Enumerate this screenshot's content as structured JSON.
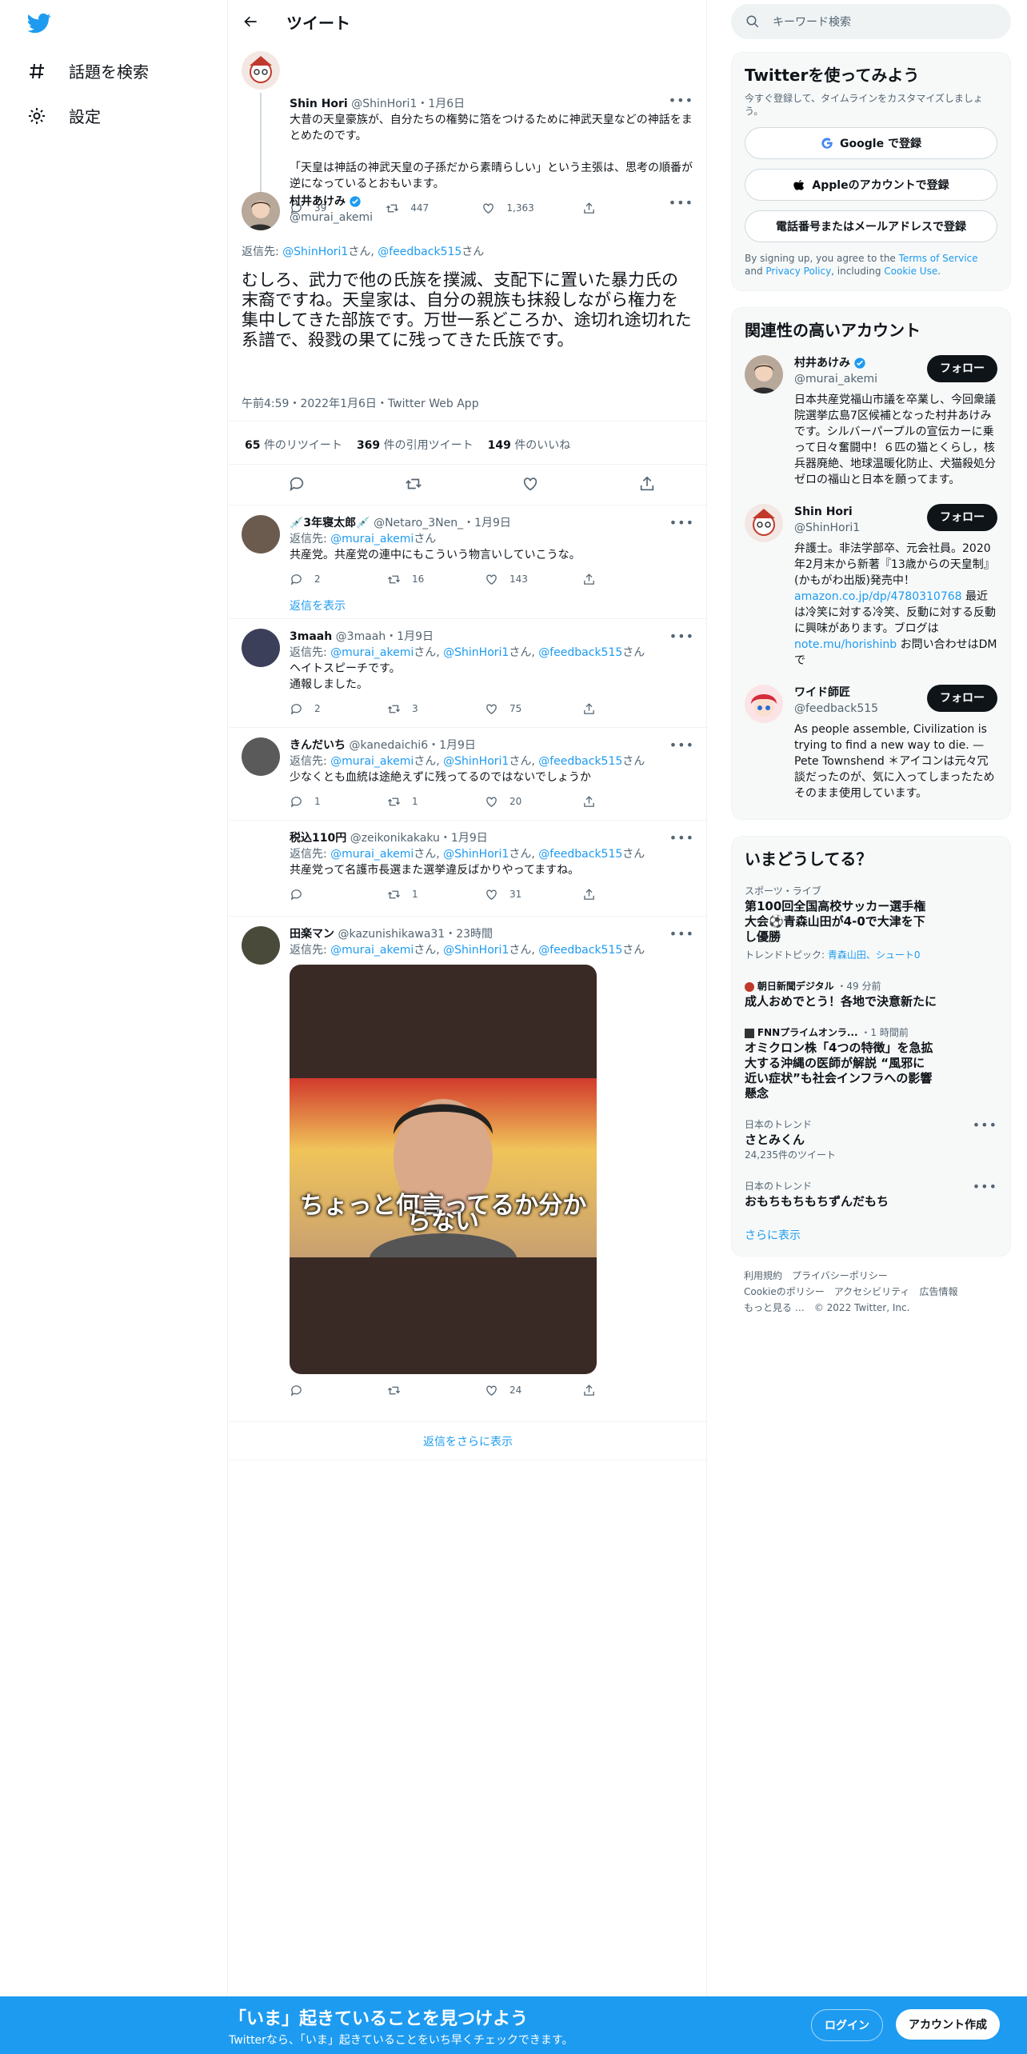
{
  "app": {
    "nav": {
      "explore": "話題を検索",
      "settings": "設定"
    }
  },
  "header": {
    "title": "ツイート"
  },
  "parent": {
    "name": "Shin Hori",
    "handle": "@ShinHori1",
    "date": "・1月6日",
    "text1": "大昔の天皇豪族が、自分たちの権勢に箔をつけるために神武天皇などの神話をまとめたのです。",
    "text2": "「天皇は神話の神武天皇の子孫だから素晴らしい」という主張は、思考の順番が逆になっているとおもいます。",
    "replies": "39",
    "retweets": "447",
    "likes": "1,363"
  },
  "main": {
    "name": "村井あけみ",
    "handle": "@murai_akemi",
    "reply_prefix": "返信先: ",
    "reply_to1": "@ShinHori1",
    "reply_san": "さん",
    "reply_comma": ", ",
    "reply_to2": "@feedback515",
    "text": "むしろ、武力で他の氏族を撲滅、支配下に置いた暴力氏の末裔ですね。天皇家は、自分の親族も抹殺しながら権力を集中してきた部族です。万世一系どころか、途切れ途切れた系譜で、殺戮の果てに残ってきた氏族です。",
    "meta": "午前4:59・2022年1月6日・Twitter Web App",
    "stats": {
      "rt_num": "65",
      "rt_label": "件のリツイート",
      "qt_num": "369",
      "qt_label": "件の引用ツイート",
      "like_num": "149",
      "like_label": "件のいいね"
    }
  },
  "replies": [
    {
      "name": "💉3年寝太郎💉",
      "handle": "@Netaro_3Nen_",
      "date": "・1月9日",
      "to": [
        "@murai_akemi"
      ],
      "text": "共産党。共産党の連中にもこういう物言いしていこうな。",
      "r": "2",
      "rt": "16",
      "l": "143",
      "show": "返信を表示"
    },
    {
      "name": "3maah",
      "handle": "@3maah",
      "date": "・1月9日",
      "to": [
        "@murai_akemi",
        "@ShinHori1",
        "@feedback515"
      ],
      "text": "ヘイトスピーチです。",
      "text2": "通報しました。",
      "r": "2",
      "rt": "3",
      "l": "75"
    },
    {
      "name": "きんだいち",
      "handle": "@kanedaichi6",
      "date": "・1月9日",
      "to": [
        "@murai_akemi",
        "@ShinHori1",
        "@feedback515"
      ],
      "text": "少なくとも血統は途絶えずに残ってるのではないでしょうか",
      "r": "1",
      "rt": "1",
      "l": "20"
    },
    {
      "name": "税込110円",
      "handle": "@zeikonikakaku",
      "date": "・1月9日",
      "to": [
        "@murai_akemi",
        "@ShinHori1",
        "@feedback515"
      ],
      "text": "共産党って名護市長選また選挙違反ばかりやってますね。",
      "r": "",
      "rt": "1",
      "l": "31"
    },
    {
      "name": "田楽マン",
      "handle": "@kazunishikawa31",
      "date": "・23時間",
      "to": [
        "@murai_akemi",
        "@ShinHori1",
        "@feedback515"
      ],
      "text": "",
      "r": "",
      "rt": "",
      "l": "24",
      "caption": "ちょっと何言ってるか分からない"
    }
  ],
  "more_replies": "返信をさらに表示",
  "sidebar": {
    "search_placeholder": "キーワード検索",
    "signup": {
      "title": "Twitterを使ってみよう",
      "desc": "今すぐ登録して、タイムラインをカスタマイズしましょう。",
      "google": "Google で登録",
      "apple": "Appleのアカウントで登録",
      "phone": "電話番号またはメールアドレスで登録",
      "terms_pre": "By signing up, you agree to the ",
      "terms": "Terms of Service",
      "and": " and ",
      "privacy": "Privacy Policy",
      "incl": ", including ",
      "cookie": "Cookie Use",
      "dot": "."
    },
    "related": {
      "title": "関連性の高いアカウント",
      "follow": "フォロー",
      "accounts": [
        {
          "name": "村井あけみ",
          "handle": "@murai_akemi",
          "bio": "日本共産党福山市議を卒業し、今回衆議院選挙広島7区候補となった村井あけみです。シルバーパープルの宣伝カーに乗って日々奮闘中！６匹の猫とくらし，核兵器廃絶、地球温暖化防止、犬猫殺処分ゼロの福山と日本を願ってます。"
        },
        {
          "name": "Shin Hori",
          "handle": "@ShinHori1",
          "bio1": "弁護士。非法学部卒、元会社員。2020年2月末から新著『13歳からの天皇制』(かもがわ出版)発売中！",
          "link1": "amazon.co.jp/dp/4780310768",
          "bio2": "最近は冷笑に対する冷笑、反動に対する反動に興味があります。ブログは",
          "link2": "note.mu/horishinb",
          "bio3": " お問い合わせはDMで"
        },
        {
          "name": "ワイド師匠",
          "handle": "@feedback515",
          "bio": "As people assemble, Civilization is trying to find a new way to die. — Pete Townshend ＊アイコンは元々冗談だったのが、気に入ってしまったためそのまま使用しています。"
        }
      ]
    },
    "trends": {
      "title": "いまどうしてる？",
      "items": [
        {
          "sub": "スポーツ・ライブ",
          "title": "第100回全国高校サッカー選手権大会⚽青森山田が4-0で大津を下し優勝",
          "topic_pre": "トレンドトピック: ",
          "topic": "青森山田、シュート0"
        },
        {
          "sub": "朝日新聞デジタル",
          "sub2": "・49 分前",
          "title": "成人おめでとう！各地で決意新たに"
        },
        {
          "sub": "FNNプライムオンラ...",
          "sub2": "・1 時間前",
          "title": "オミクロン株「4つの特徴」を急拡大する沖縄の医師が解説 “風邪に近い症状”も社会インフラへの影響懸念"
        },
        {
          "sub": "日本のトレンド",
          "title": "さとみくん",
          "count": "24,235件のツイート"
        },
        {
          "sub": "日本のトレンド",
          "title": "おもちもちもちずんだもち"
        }
      ],
      "more": "さらに表示"
    },
    "footer": {
      "terms": "利用規約",
      "privacy": "プライバシーポリシー",
      "cookie": "Cookieのポリシー",
      "access": "アクセシビリティ",
      "ads": "広告情報",
      "more": "もっと見る …",
      "copy": "© 2022 Twitter, Inc."
    }
  },
  "banner": {
    "title": "「いま」起きていることを見つけよう",
    "sub": "Twitterなら、「いま」起きていることをいち早くチェックできます。",
    "login": "ログイン",
    "signup": "アカウント作成"
  },
  "colors": {
    "accent": "#1d9bf0",
    "text": "#0f1419",
    "muted": "#536471"
  }
}
